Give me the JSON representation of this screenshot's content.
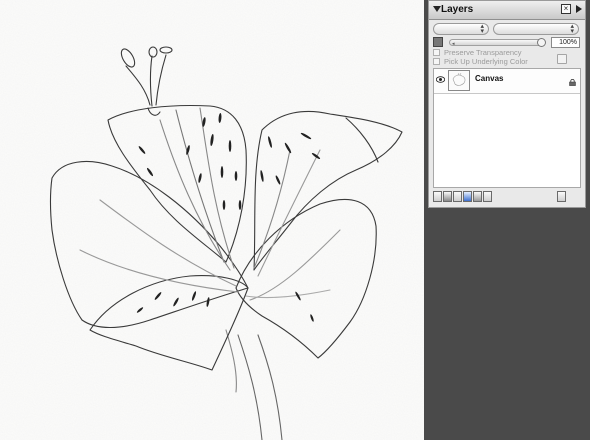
{
  "panel": {
    "title": "Layers",
    "opacity_value": "100%",
    "composite_method": "",
    "composite_depth": "",
    "options": [
      {
        "label": "Preserve Transparency",
        "checked": false
      },
      {
        "label": "Pick Up Underlying Color",
        "checked": false
      }
    ],
    "layers": [
      {
        "name": "Canvas",
        "visible": true,
        "locked": true
      }
    ],
    "bottom_icons": [
      "new-group-icon",
      "dynamic-plugins-icon",
      "adjust-icon",
      "layer-mask-icon",
      "new-layer-icon",
      "new-mask-icon",
      "delete-icon"
    ]
  },
  "colors": {
    "workspace_grey": "#4a4a4a",
    "canvas_background": "#fbfbfa",
    "panel_background": "#e9e9e9"
  }
}
